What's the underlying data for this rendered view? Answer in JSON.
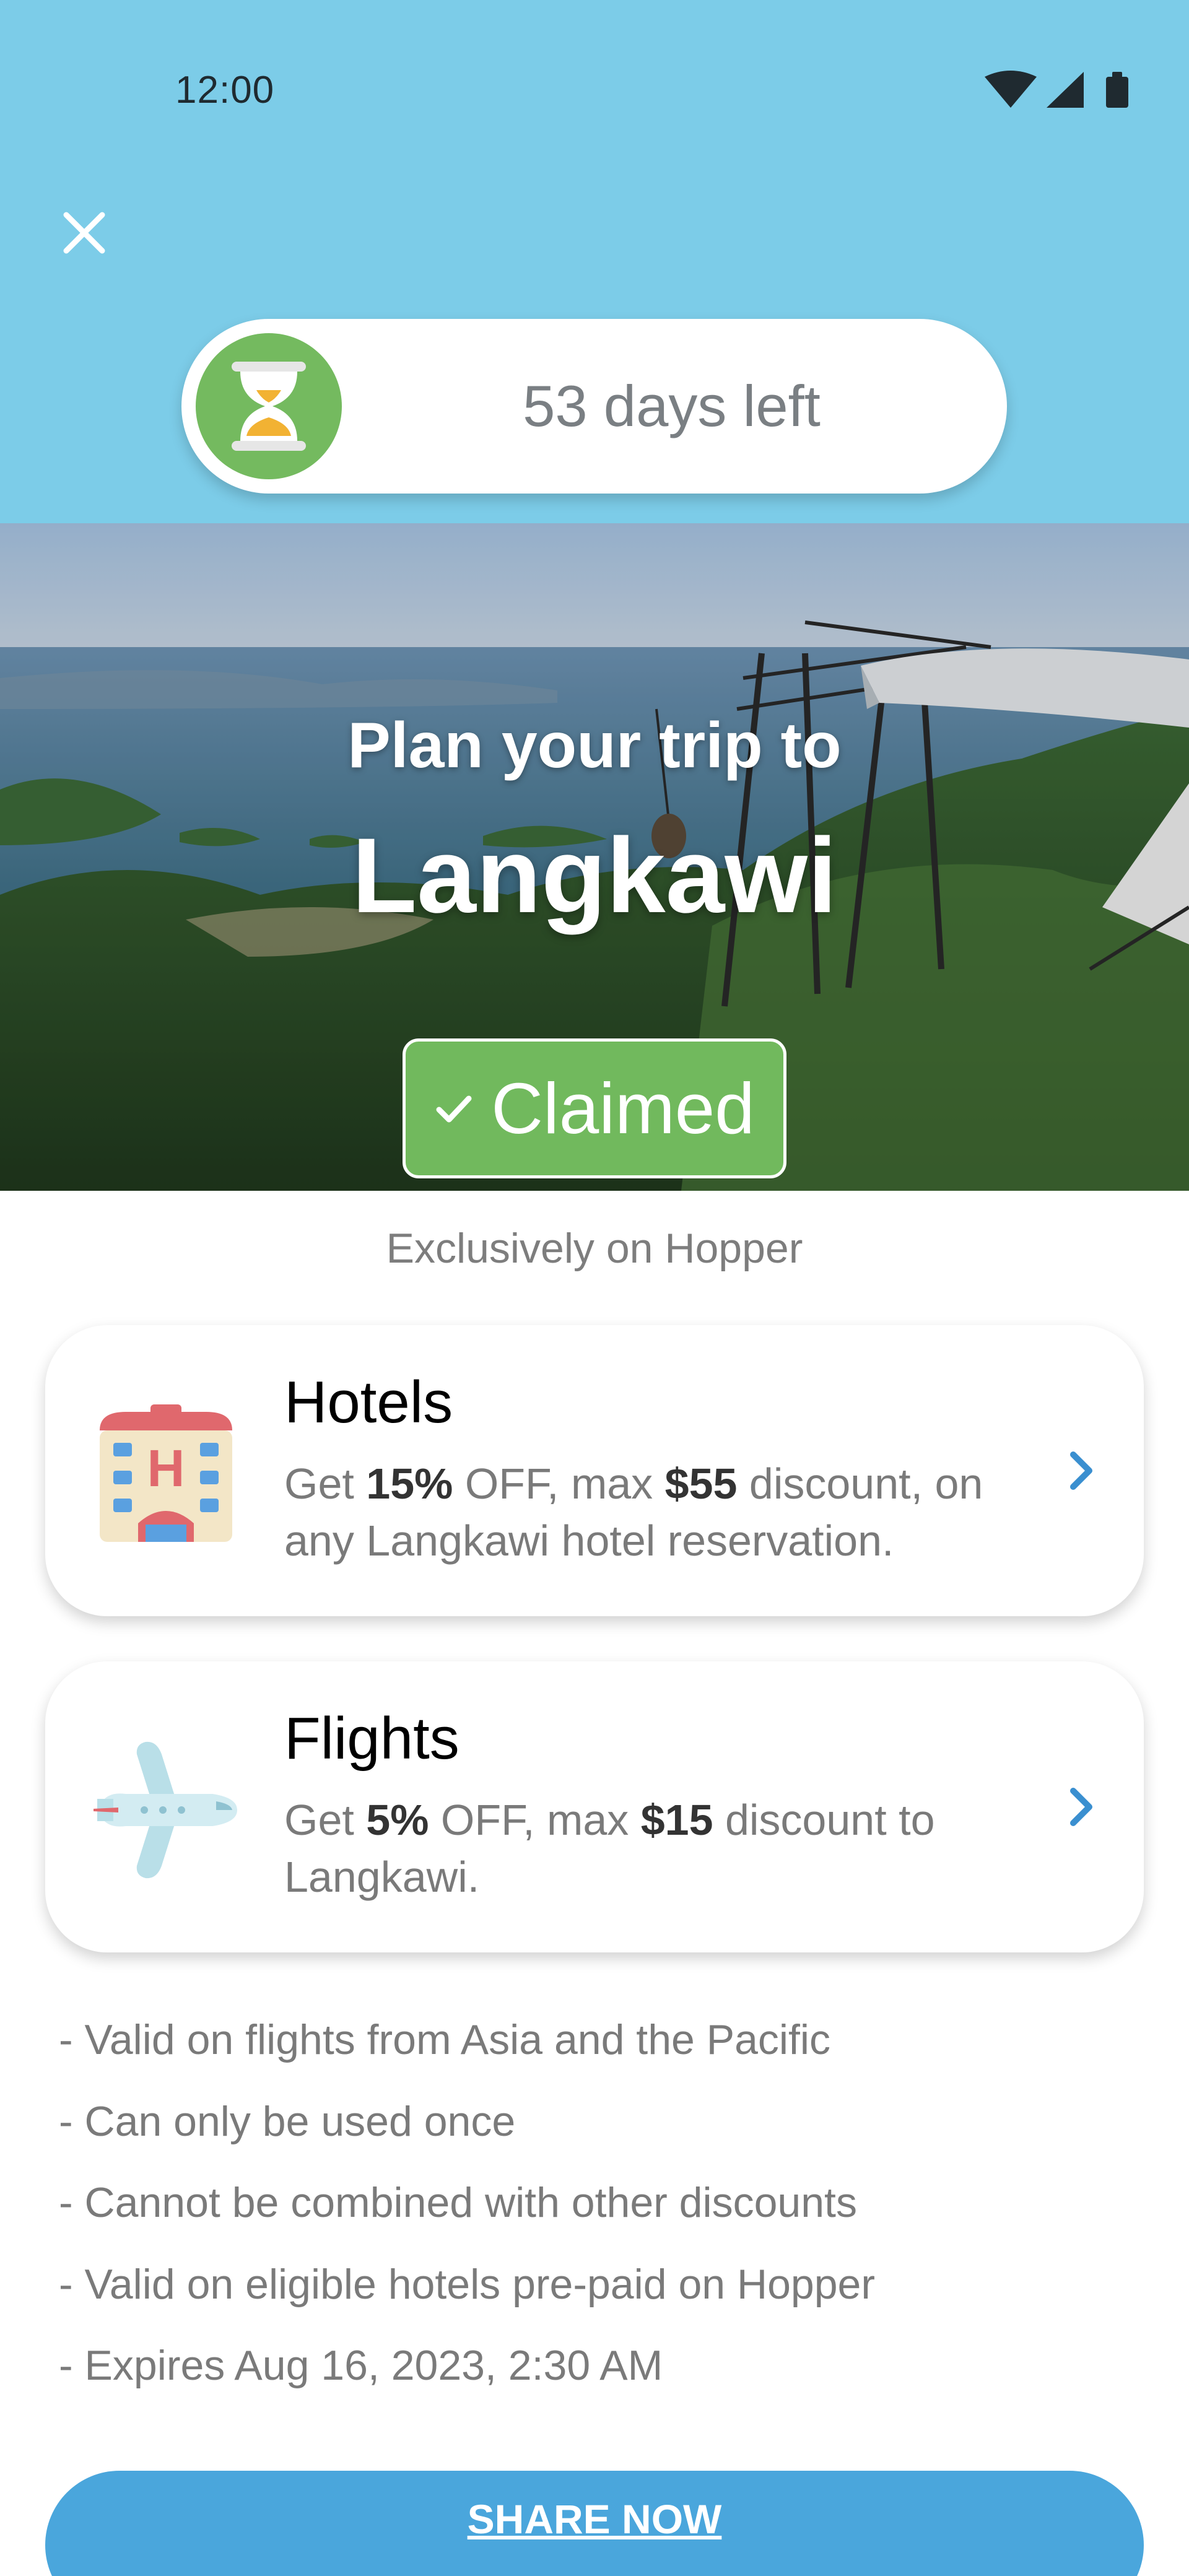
{
  "status_bar": {
    "time": "12:00"
  },
  "countdown": {
    "text": "53 days left"
  },
  "hero": {
    "title": "Plan your trip to",
    "city": "Langkawi",
    "claimed_label": "Claimed"
  },
  "exclusive_text": "Exclusively on Hopper",
  "offers": [
    {
      "title": "Hotels",
      "desc_prefix": "Get ",
      "percent": "15%",
      "desc_mid": " OFF, max ",
      "amount": "$55",
      "desc_suffix": " discount, on any Langkawi hotel reservation."
    },
    {
      "title": "Flights",
      "desc_prefix": "Get ",
      "percent": "5%",
      "desc_mid": " OFF, max ",
      "amount": "$15",
      "desc_suffix": " discount to Langkawi."
    }
  ],
  "terms": [
    "- Valid on flights from Asia and the Pacific",
    "- Can only be used once",
    "- Cannot be combined with other discounts",
    "- Valid on eligible hotels pre-paid on Hopper",
    "- Expires Aug 16, 2023, 2:30 AM"
  ],
  "share_label": "SHARE NOW",
  "colors": {
    "header_bg": "#7ccce8",
    "accent_green": "#71b95d",
    "share_blue": "#4aa6dc",
    "chevron_blue": "#3a8fd0"
  },
  "icons": [
    "close-icon",
    "hourglass-icon",
    "check-icon",
    "hotel-icon",
    "airplane-icon",
    "chevron-right-icon",
    "wifi-icon",
    "signal-icon",
    "battery-icon"
  ]
}
